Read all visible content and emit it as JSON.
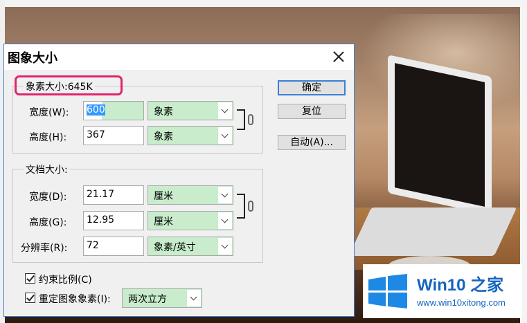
{
  "dialog": {
    "title": "图象大小",
    "pixel_size": {
      "legend": "象素大小:645K",
      "width_label": "宽度(W):",
      "width_value": "600",
      "width_unit": "象素",
      "height_label": "高度(H):",
      "height_value": "367",
      "height_unit": "象素"
    },
    "document_size": {
      "legend": "文档大小:",
      "width_label": "宽度(D):",
      "width_value": "21.17",
      "width_unit": "厘米",
      "height_label": "高度(G):",
      "height_value": "12.95",
      "height_unit": "厘米",
      "resolution_label": "分辨率(R):",
      "resolution_value": "72",
      "resolution_unit": "象素/英寸"
    },
    "options": {
      "constrain_label": "约束比例(C)",
      "constrain_checked": true,
      "resample_label": "重定图象象素(I):",
      "resample_checked": true,
      "resample_method": "两次立方"
    },
    "buttons": {
      "ok": "确定",
      "reset": "复位",
      "auto": "自动(A)..."
    }
  },
  "watermark": {
    "title": "Win10 之家",
    "url": "www.win10xitong.com"
  },
  "colors": {
    "highlight": "#e0246e",
    "brand_blue": "#1565c0",
    "select_bg": "#c8eccc"
  }
}
